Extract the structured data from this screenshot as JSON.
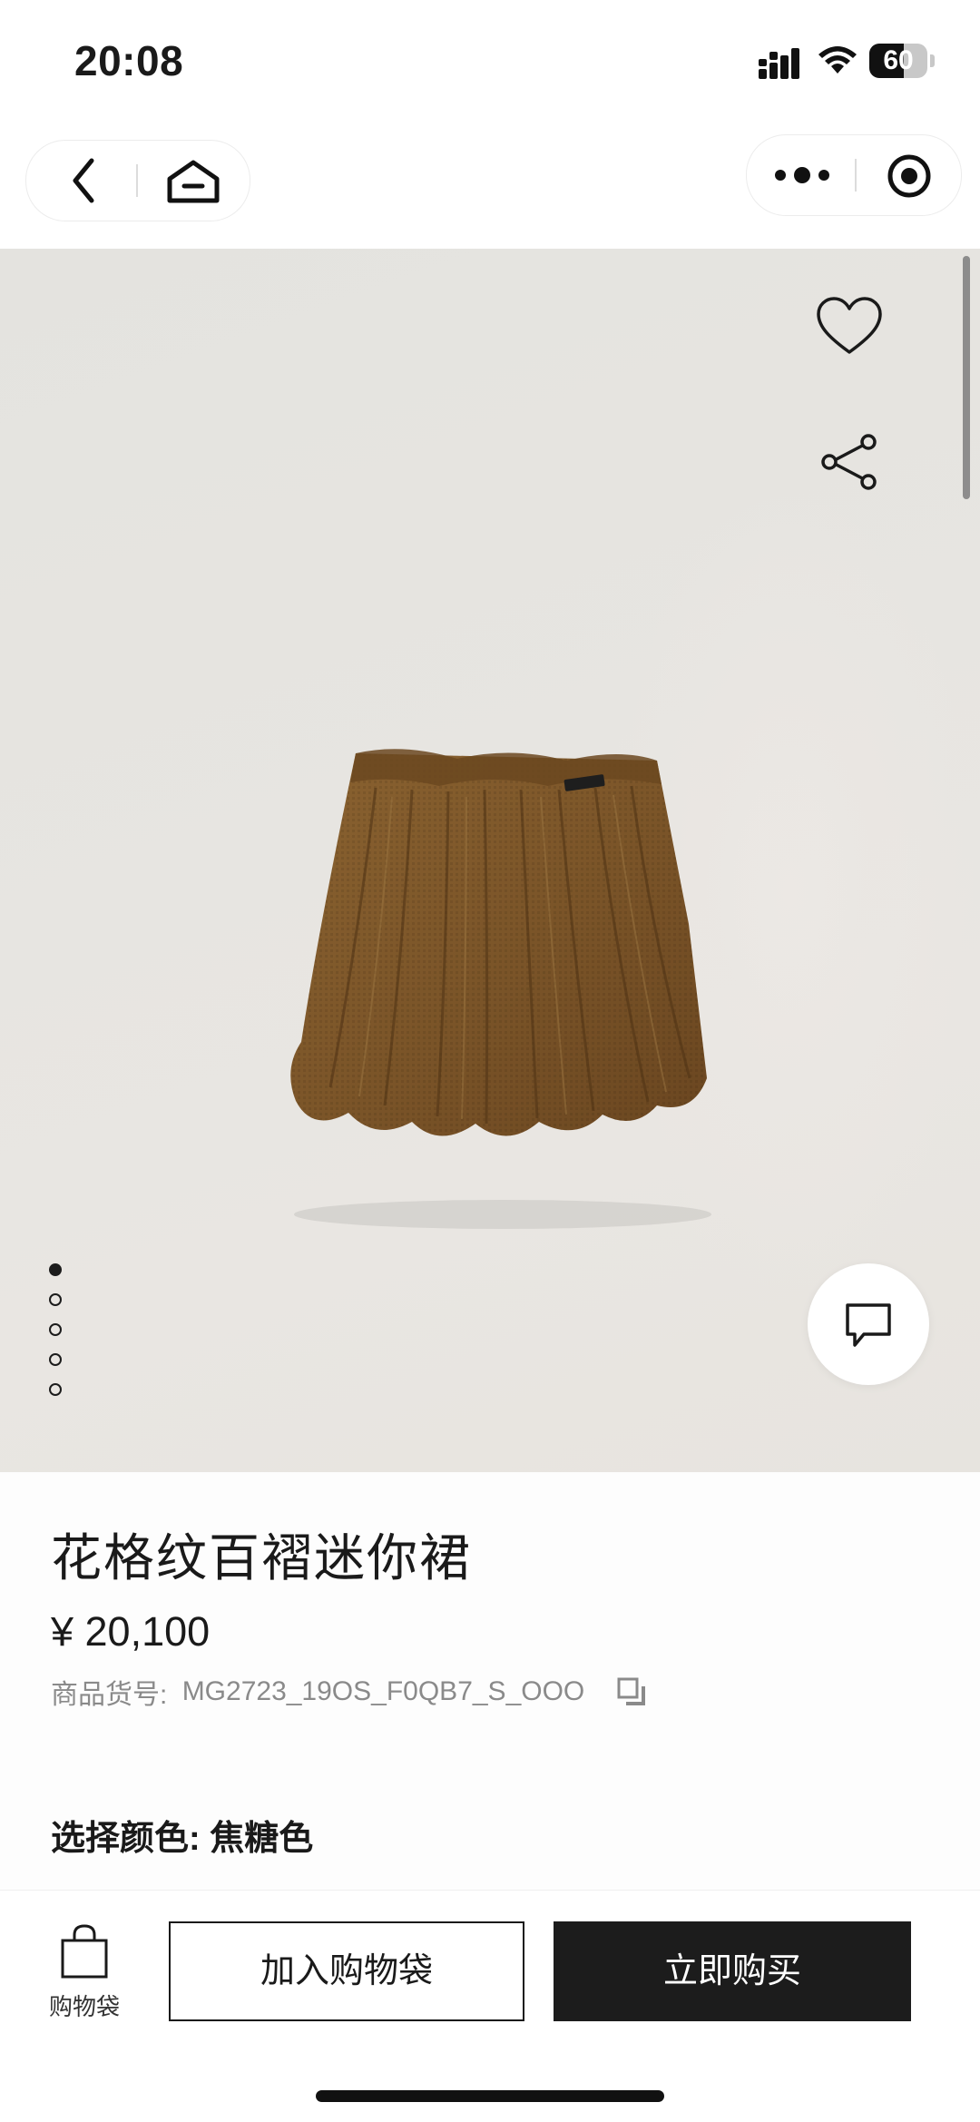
{
  "status_bar": {
    "time": "20:08",
    "battery": 60
  },
  "nav": {
    "left_icons": [
      "back-icon",
      "home-icon"
    ],
    "right_icons": [
      "more-dots-icon",
      "target-icon"
    ]
  },
  "hero": {
    "product_icon": "pleated-mini-skirt",
    "pager": {
      "total": 5,
      "active": 1
    },
    "actions": [
      "heart-icon",
      "share-icon"
    ],
    "chat_icon": "chat-bubble-icon"
  },
  "product": {
    "title": "花格纹百褶迷你裙",
    "price": "¥ 20,100",
    "sku_label": "商品货号:",
    "sku_value": "MG2723_19OS_F0QB7_S_OOO",
    "color_label": "选择颜色:",
    "color_value": "焦糖色",
    "colors": {
      "skirt": "#7a5528",
      "hero_bg": "#e6e4e0"
    }
  },
  "bottom_bar": {
    "bag_label": "购物袋",
    "add_to_bag": "加入购物袋",
    "buy_now": "立即购买"
  }
}
